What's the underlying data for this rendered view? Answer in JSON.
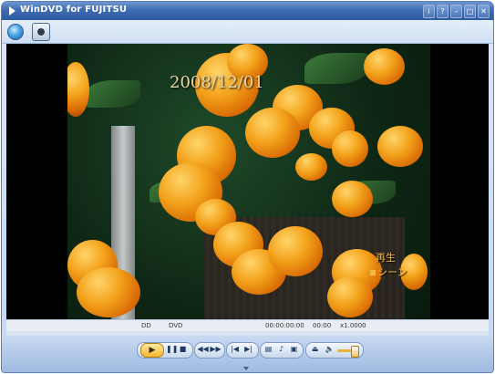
{
  "window": {
    "title": "WinDVD for FUJITSU"
  },
  "titlebar_controls": [
    {
      "name": "info-button",
      "glyph": "i"
    },
    {
      "name": "help-button",
      "glyph": "?"
    },
    {
      "name": "minimize-button",
      "glyph": "–"
    },
    {
      "name": "maximize-button",
      "glyph": "□"
    },
    {
      "name": "close-button",
      "glyph": "✕"
    }
  ],
  "toolbar": {
    "items": [
      {
        "name": "media-globe-icon"
      },
      {
        "name": "capture-icon"
      }
    ]
  },
  "video": {
    "date_stamp": "2008/12/01",
    "osd_line1": "再生",
    "osd_line2": "シーン"
  },
  "statusbar": {
    "chapter_label": "DD",
    "format_label": "DVD",
    "timecode": "00:00:00:00",
    "counter": "00:00",
    "rate": "x1.0000"
  },
  "controls": {
    "play": "▶",
    "pause": "❚❚",
    "stop": "■",
    "rewind": "◀◀",
    "forward": "▶▶",
    "prev": "|◀",
    "next": "▶|",
    "subtitle": "▤",
    "audio": "♪",
    "angle": "▣",
    "eject": "⏏",
    "volume": "🔈"
  },
  "colors": {
    "accent": "#3e6cb1",
    "play_highlight": "#f5b82e",
    "osd_text": "#f3b84a"
  }
}
